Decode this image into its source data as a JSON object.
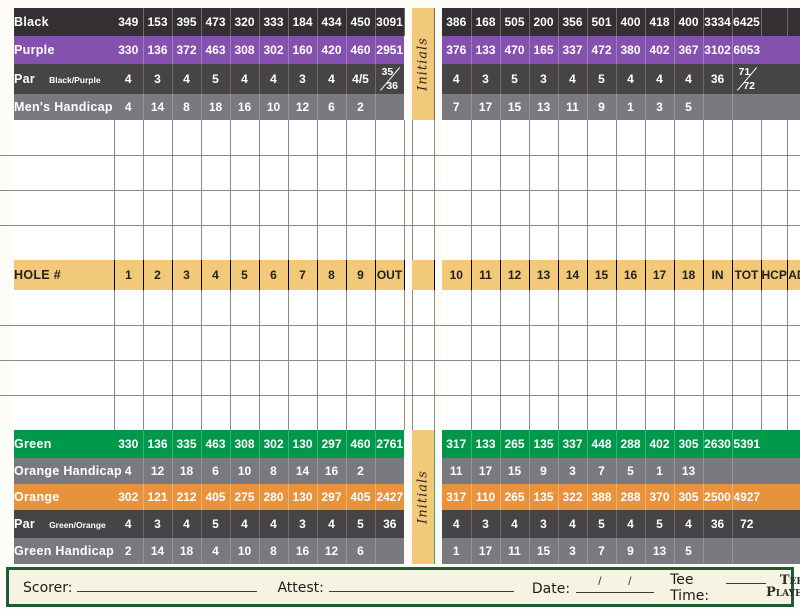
{
  "colors": {
    "black": "#332f33",
    "purple": "#8452ae",
    "par": "#474448",
    "handicap": "#7b7980",
    "green": "#009949",
    "orange": "#e8923c",
    "tan": "#f2c879",
    "border_green": "#1d5c33",
    "footer_bg": "#f7f3e3"
  },
  "initials_label": "Initials",
  "front": {
    "holes": [
      "1",
      "2",
      "3",
      "4",
      "5",
      "6",
      "7",
      "8",
      "9"
    ],
    "out": "OUT"
  },
  "back": {
    "holes": [
      "10",
      "11",
      "12",
      "13",
      "14",
      "15",
      "16",
      "17",
      "18"
    ],
    "in": "IN",
    "tot": "TOT",
    "hcp": "HCP",
    "adj": "ADJ"
  },
  "hole_row": {
    "label": "HOLE #"
  },
  "top": {
    "black": {
      "label": "Black",
      "front": [
        "349",
        "153",
        "395",
        "473",
        "320",
        "333",
        "184",
        "434",
        "450"
      ],
      "out": "3091",
      "back": [
        "386",
        "168",
        "505",
        "200",
        "356",
        "501",
        "400",
        "418",
        "400"
      ],
      "in": "3334",
      "tot": "6425"
    },
    "purple": {
      "label": "Purple",
      "front": [
        "330",
        "136",
        "372",
        "463",
        "308",
        "302",
        "160",
        "420",
        "460"
      ],
      "out": "2951",
      "back": [
        "376",
        "133",
        "470",
        "165",
        "337",
        "472",
        "380",
        "402",
        "367"
      ],
      "in": "3102",
      "tot": "6053"
    },
    "par": {
      "label": "Par",
      "sub": "Black/Purple",
      "front": [
        "4",
        "3",
        "4",
        "5",
        "4",
        "4",
        "3",
        "4",
        "4/5"
      ],
      "out_top": "35",
      "out_bottom": "36",
      "back": [
        "4",
        "3",
        "5",
        "3",
        "4",
        "5",
        "4",
        "4",
        "4"
      ],
      "in": "36",
      "tot_top": "71",
      "tot_bottom": "72"
    },
    "mens_handicap": {
      "label": "Men's Handicap",
      "front": [
        "4",
        "14",
        "8",
        "18",
        "16",
        "10",
        "12",
        "6",
        "2"
      ],
      "out": "",
      "back": [
        "7",
        "17",
        "15",
        "13",
        "11",
        "9",
        "1",
        "3",
        "5"
      ],
      "in": "",
      "tot": ""
    }
  },
  "bottom": {
    "green": {
      "label": "Green",
      "front": [
        "330",
        "136",
        "335",
        "463",
        "308",
        "302",
        "130",
        "297",
        "460"
      ],
      "out": "2761",
      "back": [
        "317",
        "133",
        "265",
        "135",
        "337",
        "448",
        "288",
        "402",
        "305"
      ],
      "in": "2630",
      "tot": "5391"
    },
    "orange_handicap": {
      "label": "Orange Handicap",
      "front": [
        "4",
        "12",
        "18",
        "6",
        "10",
        "8",
        "14",
        "16",
        "2"
      ],
      "out": "",
      "back": [
        "11",
        "17",
        "15",
        "9",
        "3",
        "7",
        "5",
        "1",
        "13"
      ],
      "in": "",
      "tot": ""
    },
    "orange": {
      "label": "Orange",
      "front": [
        "302",
        "121",
        "212",
        "405",
        "275",
        "280",
        "130",
        "297",
        "405"
      ],
      "out": "2427",
      "back": [
        "317",
        "110",
        "265",
        "135",
        "322",
        "388",
        "288",
        "370",
        "305"
      ],
      "in": "2500",
      "tot": "4927"
    },
    "par": {
      "label": "Par",
      "sub": "Green/Orange",
      "front": [
        "4",
        "3",
        "4",
        "5",
        "4",
        "4",
        "3",
        "4",
        "5"
      ],
      "out": "36",
      "back": [
        "4",
        "3",
        "4",
        "3",
        "4",
        "5",
        "4",
        "5",
        "4"
      ],
      "in": "36",
      "tot": "72"
    },
    "green_handicap": {
      "label": "Green Handicap",
      "front": [
        "2",
        "14",
        "18",
        "4",
        "10",
        "8",
        "16",
        "12",
        "6"
      ],
      "out": "",
      "back": [
        "1",
        "17",
        "11",
        "15",
        "3",
        "7",
        "9",
        "13",
        "5"
      ],
      "in": "",
      "tot": ""
    }
  },
  "footer": {
    "scorer": "Scorer:",
    "attest": "Attest:",
    "date": "Date:",
    "date_sep1": "/",
    "date_sep2": "/",
    "tee_time": "Tee Time:",
    "tees_line1": "Tees",
    "tees_line2": "Played",
    "tee_colors": [
      "#1a1a1a",
      "#8452ae",
      "#009949",
      "#e8923c"
    ]
  }
}
